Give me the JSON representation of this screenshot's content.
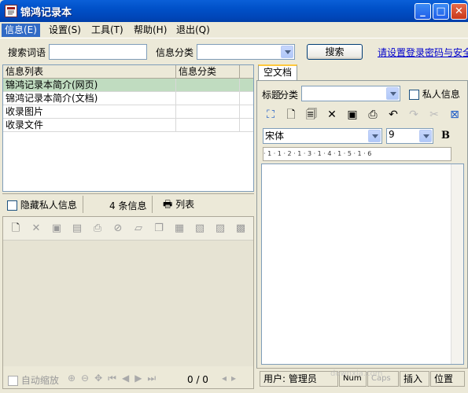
{
  "window": {
    "title": "锦鸿记录本",
    "min": "_",
    "max": "□",
    "close": "✕"
  },
  "menu": [
    {
      "label": "信息(E)"
    },
    {
      "label": "设置(S)"
    },
    {
      "label": "工具(T)"
    },
    {
      "label": "帮助(H)"
    },
    {
      "label": "退出(Q)"
    }
  ],
  "search": {
    "label": "搜索词语",
    "value": "",
    "category_label": "信息分类",
    "category_value": "",
    "button": "搜索",
    "link": "请设置登录密码与安全"
  },
  "list": {
    "headers": [
      "信息列表",
      "信息分类"
    ],
    "rows": [
      {
        "title": "锦鸿记录本简介(网页)",
        "category": ""
      },
      {
        "title": "锦鸿记录本简介(文档)",
        "category": ""
      },
      {
        "title": "收录图片",
        "category": ""
      },
      {
        "title": "收录文件",
        "category": ""
      }
    ],
    "hide_private": "隐藏私人信息",
    "count": "4 条信息",
    "list_button": "列表"
  },
  "lower": {
    "autozoom": "自动缩放",
    "page": "0 / 0"
  },
  "right": {
    "tab": "空文档",
    "title_label": "标题",
    "category_label": "分类",
    "private_label": "私人信息",
    "font": "宋体",
    "size": "9",
    "bold": "B",
    "ruler": "· 1 · 1 · 2 · 1 · 3 · 1 · 4 · 1 · 5 · 1 · 6"
  },
  "status": {
    "user": "用户: 管理员",
    "num": "Num",
    "caps": "Caps",
    "insert": "插入",
    "position": "位置"
  },
  "watermark": "downxia.com",
  "icons": [
    "new-icon",
    "delete-icon",
    "save-icon",
    "saveas-icon",
    "print-icon",
    "cancel-icon",
    "open-folder-icon",
    "copy-icon",
    "export-icon",
    "import-icon",
    "paste-icon",
    "attach-icon"
  ]
}
